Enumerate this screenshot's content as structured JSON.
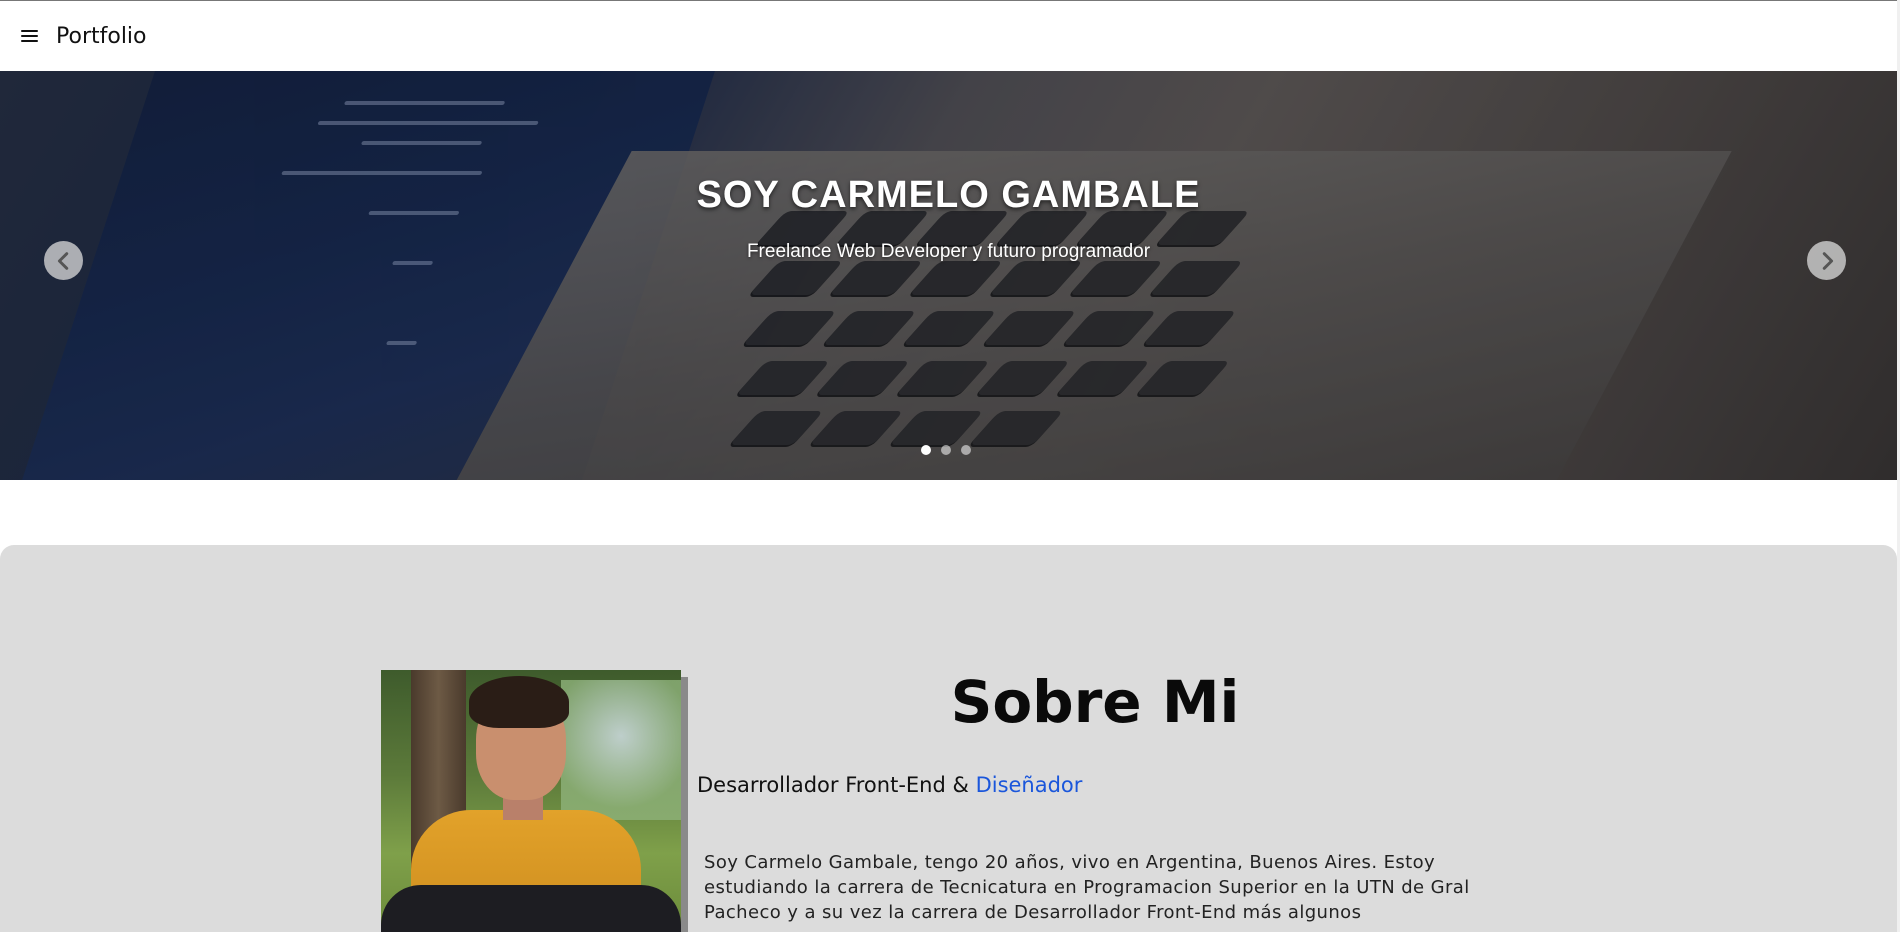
{
  "navbar": {
    "brand": "Portfolio",
    "menu_icon": "hamburger-menu-icon"
  },
  "hero": {
    "title": "SOY CARMELO GAMBALE",
    "subtitle": "Freelance Web Developer y futuro programador",
    "prev_icon": "chevron-left-icon",
    "next_icon": "chevron-right-icon",
    "slides": 3,
    "active_slide": 1
  },
  "about": {
    "title": "Sobre Mi",
    "role_prefix": "Desarrollador Front-End &",
    "role_accent": "Diseñador",
    "description": "Soy Carmelo Gambale, tengo 20 años, vivo en Argentina, Buenos Aires. Estoy estudiando la carrera de Tecnicatura en Programacion Superior en la UTN de Gral Pacheco y a su vez la carrera de Desarrollador Front-End más algunos",
    "photo_alt": "profile photo"
  },
  "colors": {
    "accent": "#1a56db",
    "about_bg": "#dcdcdc",
    "hoodie": "#e2a22a"
  }
}
